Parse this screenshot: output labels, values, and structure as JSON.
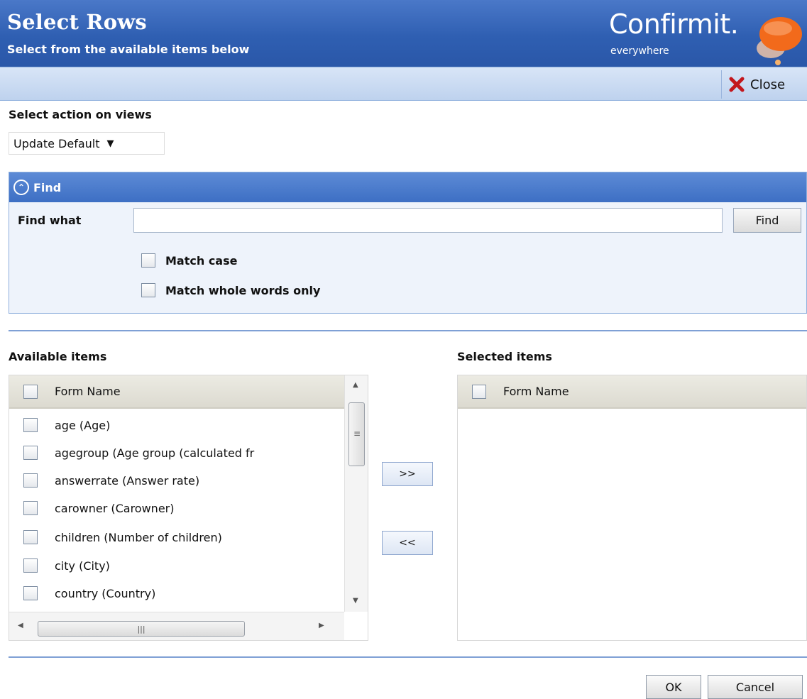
{
  "header": {
    "title": "Select Rows",
    "subtitle": "Select from the available items below",
    "logo_brand": "Confirmit.",
    "logo_tagline": "everywhere"
  },
  "toolbar": {
    "close_label": "Close",
    "close_icon": "close-x-icon"
  },
  "action": {
    "label": "Select action on views",
    "selected": "Update Default"
  },
  "find": {
    "header": "Find",
    "find_what_label": "Find what",
    "input_value": "",
    "button_label": "Find",
    "match_case_label": "Match case",
    "match_whole_label": "Match whole words only"
  },
  "available": {
    "label": "Available items",
    "column_header": "Form Name",
    "items": [
      "age (Age)",
      "agegroup (Age group (calculated fr",
      "answerrate (Answer rate)",
      "carowner (Carowner)",
      "children (Number of children)",
      "city (City)",
      "country (Country)"
    ]
  },
  "transfer": {
    "add_label": ">>",
    "remove_label": "<<"
  },
  "selected": {
    "label": "Selected items",
    "column_header": "Form Name",
    "items": []
  },
  "footer": {
    "ok_label": "OK",
    "cancel_label": "Cancel"
  },
  "colors": {
    "header_blue": "#2f5fb2",
    "toolbar_blue": "#c8d9f2",
    "accent_orange": "#f07a1a"
  }
}
